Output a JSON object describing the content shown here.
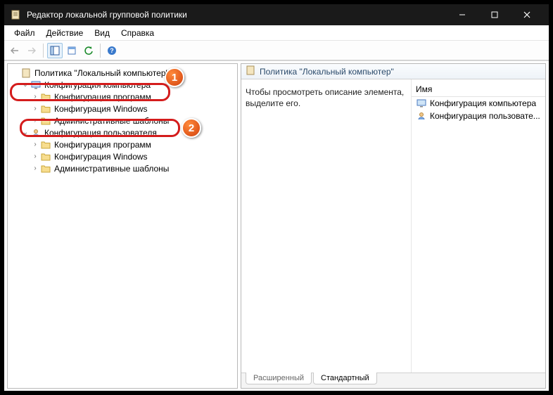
{
  "window": {
    "title": "Редактор локальной групповой политики"
  },
  "menu": {
    "file": "Файл",
    "action": "Действие",
    "view": "Вид",
    "help": "Справка"
  },
  "tree": {
    "root": "Политика \"Локальный компьютер\"",
    "comp_config": "Конфигурация компьютера",
    "comp_children": {
      "software": "Конфигурация программ",
      "windows": "Конфигурация Windows",
      "admin": "Административные шаблоны"
    },
    "user_config": "Конфигурация пользователя",
    "user_children": {
      "software": "Конфигурация программ",
      "windows": "Конфигурация Windows",
      "admin": "Административные шаблоны"
    }
  },
  "pane": {
    "header": "Политика \"Локальный компьютер\"",
    "description": "Чтобы просмотреть описание элемента, выделите его.",
    "col_name": "Имя",
    "items": {
      "comp": "Конфигурация компьютера",
      "user": "Конфигурация пользовате..."
    }
  },
  "tabs": {
    "extended": "Расширенный",
    "standard": "Стандартный"
  },
  "annotations": {
    "badge1": "1",
    "badge2": "2"
  }
}
